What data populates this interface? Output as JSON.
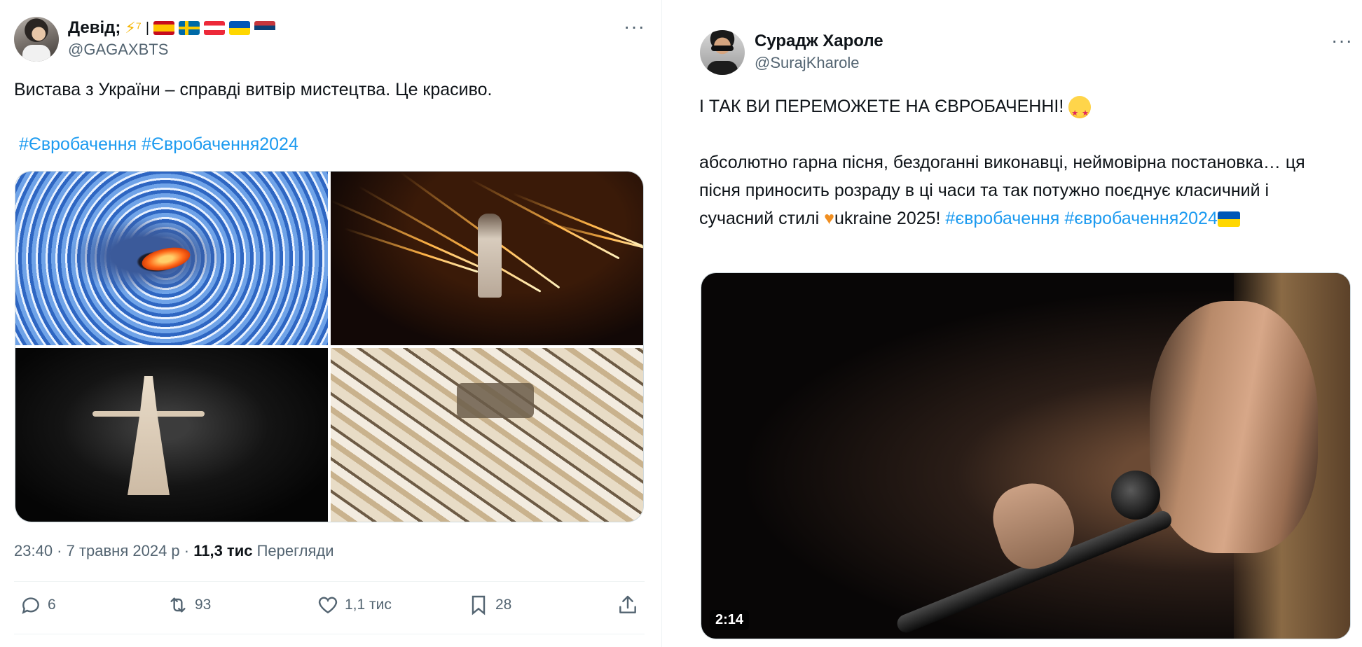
{
  "tweet_left": {
    "author_name": "Девід; ",
    "author_badge_suffix": "⚡⁷",
    "separator": "|",
    "flags": [
      "es",
      "se",
      "at",
      "ua",
      "rs"
    ],
    "handle": "@GAGAXBTS",
    "text": "Вистава з України – справді витвір мистецтва. Це красиво.",
    "hashtags": [
      "#Євробачення",
      "#Євробачення2024"
    ],
    "timestamp": "23:40 · 7 травня 2024 р · ",
    "views_count": "11,3 тис",
    "views_label": " Перегляди",
    "actions": {
      "reply_count": "6",
      "retweet_count": "93",
      "like_count": "1,1 тис",
      "bookmark_count": "28"
    }
  },
  "tweet_right": {
    "author_name": "Сурадж Хароле",
    "handle": "@SurajKharole",
    "line1": "І ТАК ВИ ПЕРЕМОЖЕТЕ НА ЄВРОБАЧЕННІ! ",
    "line2": "абсолютно гарна пісня, бездоганні виконавці, неймовірна постановка… ця пісня приносить розраду в ці часи та так потужно поєднує класичний і сучасний стилі ",
    "line2_after_heart": "ukraine 2025! ",
    "hashtag1": "#євробачення",
    "hashtag2": "#євробачення2024",
    "heart_glyph": "♥",
    "video_duration": "2:14"
  },
  "icons": {
    "more": "more-horizontal-icon",
    "reply": "reply-icon",
    "retweet": "retweet-icon",
    "like": "heart-icon",
    "bookmark": "bookmark-icon",
    "share": "share-icon"
  },
  "colors": {
    "link": "#1d9bf0",
    "secondary_text": "#536471",
    "primary_text": "#0f1419"
  },
  "more_glyph": "···"
}
